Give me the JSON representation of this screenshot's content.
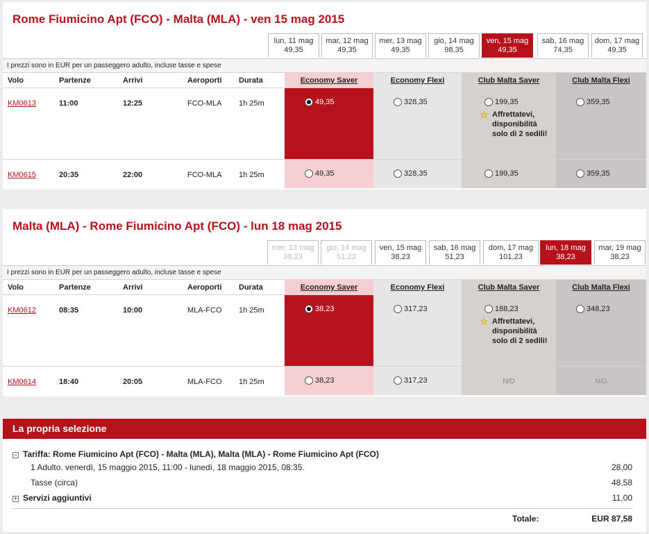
{
  "colors": {
    "accent": "#b5121b",
    "selected_fare": "#b5121b",
    "saver_light": "#f5cfd1",
    "flexi_bg": "#e6e6e6",
    "club_saver_bg": "#d4d1cf",
    "club_flexi_bg": "#c8c5c4"
  },
  "info_text": "I prezzi sono in EUR per un passeggero adulto, incluse tasse e spese",
  "columns": {
    "volo": "Volo",
    "partenze": "Partenze",
    "arrivi": "Arrivi",
    "aeroporti": "Aeroporti",
    "durata": "Durata"
  },
  "fare_names": [
    "Economy Saver",
    "Economy Flexi",
    "Club Malta Saver",
    "Club Malta Flexi"
  ],
  "outbound": {
    "title": "Rome Fiumicino Apt (FCO) - Malta (MLA) - ven 15 mag 2015",
    "dates": [
      {
        "day": "lun, 11 mag",
        "price": "49,35"
      },
      {
        "day": "mar, 12 mag",
        "price": "49,35"
      },
      {
        "day": "mer, 13 mag",
        "price": "49,35"
      },
      {
        "day": "gio, 14 mag",
        "price": "98,35"
      },
      {
        "day": "ven, 15 mag",
        "price": "49,35"
      },
      {
        "day": "sab, 16 mag",
        "price": "74,35"
      },
      {
        "day": "dom, 17 mag",
        "price": "49,35"
      }
    ],
    "flights": [
      {
        "code": "KM0613",
        "dep": "11:00",
        "arr": "12:25",
        "airports": "FCO-MLA",
        "duration": "1h 25m",
        "fares": [
          "49,35",
          "328,35",
          "199,35",
          "359,35"
        ],
        "warning": "Affrettatevi, disponibilità solo di 2 sedili!"
      },
      {
        "code": "KM0615",
        "dep": "20:35",
        "arr": "22:00",
        "airports": "FCO-MLA",
        "duration": "1h 25m",
        "fares": [
          "49,35",
          "328,35",
          "199,35",
          "359,35"
        ]
      }
    ]
  },
  "inbound": {
    "title": "Malta (MLA) - Rome Fiumicino Apt (FCO) - lun 18 mag 2015",
    "dates": [
      {
        "day": "mer, 13 mag",
        "price": "38,23"
      },
      {
        "day": "gio, 14 mag",
        "price": "51,23"
      },
      {
        "day": "ven, 15 mag",
        "price": "38,23"
      },
      {
        "day": "sab, 16 mag",
        "price": "51,23"
      },
      {
        "day": "dom, 17 mag",
        "price": "101,23"
      },
      {
        "day": "lun, 18 mag",
        "price": "38,23"
      },
      {
        "day": "mar, 19 mag",
        "price": "38,23"
      }
    ],
    "flights": [
      {
        "code": "KM0612",
        "dep": "08:35",
        "arr": "10:00",
        "airports": "MLA-FCO",
        "duration": "1h 25m",
        "fares": [
          "38,23",
          "317,23",
          "188,23",
          "348,23"
        ],
        "warning": "Affrettatevi, disponibilità solo di 2 sedili!"
      },
      {
        "code": "KM0614",
        "dep": "18:40",
        "arr": "20:05",
        "airports": "MLA-FCO",
        "duration": "1h 25m",
        "fares": [
          "38,23",
          "317,23",
          "N/D",
          "N/D"
        ]
      }
    ]
  },
  "selection": {
    "title": "La propria selezione",
    "fare_label": "Tariffa: Rome Fiumicino Apt (FCO) - Malta (MLA), Malta (MLA) - Rome Fiumicino Apt (FCO)",
    "fare_toggle": "−",
    "passenger_line": "1 Adulto. venerdì, 15 maggio 2015, 11:00 - lunedì, 18 maggio 2015, 08:35.",
    "passenger_amount": "28,00",
    "taxes_label": "Tasse (circa)",
    "taxes_amount": "48,58",
    "services_label": "Servizi aggiuntivi",
    "services_toggle": "+",
    "services_amount": "11,00",
    "total_label": "Totale:",
    "total_value": "EUR 87,58"
  }
}
